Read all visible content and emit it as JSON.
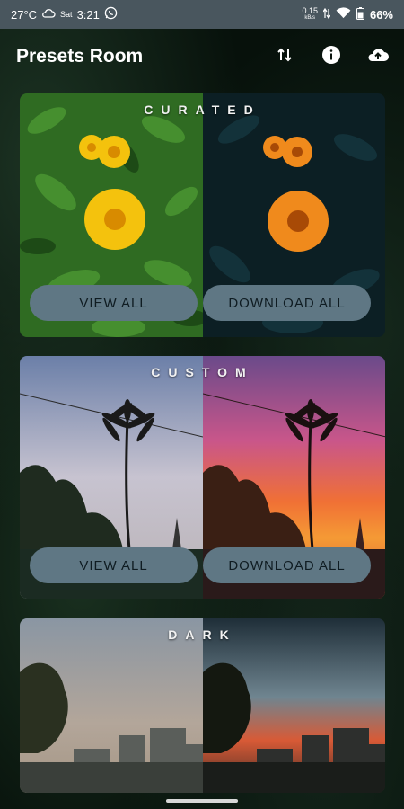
{
  "status": {
    "temperature": "27°C",
    "day": "Sat",
    "time": "3:21",
    "net_speed": "0.15",
    "net_unit": "kB/s",
    "battery": "66%"
  },
  "header": {
    "title": "Presets Room"
  },
  "sections": [
    {
      "title": "CURATED",
      "view_label": "VIEW ALL",
      "download_label": "DOWNLOAD ALL"
    },
    {
      "title": "CUSTOM",
      "view_label": "VIEW ALL",
      "download_label": "DOWNLOAD ALL"
    },
    {
      "title": "DARK"
    }
  ],
  "colors": {
    "status_bar": "#49565e",
    "pill": "#5f7784",
    "pill_text": "#0f1c22"
  },
  "icons": [
    "sort-icon",
    "info-icon",
    "cloud-upload-icon",
    "cloud-icon",
    "whatsapp-icon",
    "wifi-icon",
    "battery-icon"
  ]
}
